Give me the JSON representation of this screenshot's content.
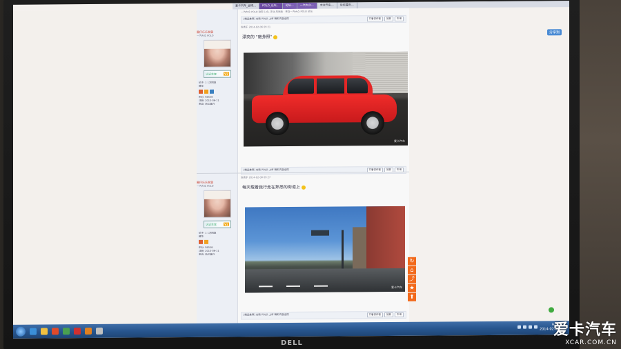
{
  "browser": {
    "tabs": [
      {
        "label": "爱卡汽车_全球…",
        "active": false
      },
      {
        "label": "POLO_论坛…",
        "active": true
      },
      {
        "label": "论坛…",
        "active": false
      },
      {
        "label": "一汽大众…",
        "active": false
      },
      {
        "label": "大众汽车…",
        "active": false
      },
      {
        "label": "论坛首页…",
        "active": false
      }
    ]
  },
  "posts": [
    {
      "author": {
        "name": "圈仔乐乐家里",
        "sub": "一汽大众 POLO",
        "badge": "认证车友",
        "level": "V2",
        "stats": [
          "帖子: 1  1万回复",
          "精华",
          "积分: 98556",
          "注册: 2013-06-11",
          "来自: 浙江嘉兴"
        ]
      },
      "head": "一汽大众 POLO 劲取 1.6L 手动 风尚版 · 来自一汽大众 POLO 论坛",
      "sig": "[精品推荐] 全新 POLO 上市 精彩内容全揽",
      "floor_time": "发表于 2014-02-06 09:21",
      "caption": "漂亮的 \"魅身照\"",
      "buttons": [
        "只看该作者",
        "回复",
        "引用"
      ],
      "photo_watermark": "爱卡汽车"
    },
    {
      "author": {
        "name": "圈仔乐乐家里",
        "sub": "一汽大众 POLO",
        "badge": "认证车友",
        "level": "V2",
        "stats": [
          "帖子: 1  1万回复",
          "精华",
          "积分: 98556",
          "注册: 2013-06-11",
          "来自: 浙江嘉兴"
        ]
      },
      "head": "发表于 2014-02-06 09:27",
      "sig": "[精品推荐] 全新 POLO 上市 精彩内容全揽",
      "caption": "每天载着我行走在熟悉的街道上",
      "buttons": [
        "只看该作者",
        "回复",
        "引用"
      ],
      "photo_watermark": "爱卡汽车"
    }
  ],
  "side_tools": [
    "↻",
    "⌂",
    "⤴",
    "★",
    "⬆"
  ],
  "share_label": "分享到",
  "taskbar": {
    "clock_time": "9:48",
    "clock_date": "2014-02-07"
  },
  "bezel_logo": "DELL",
  "watermark": {
    "big": "爱卡汽车",
    "small": "XCAR.COM.CN"
  }
}
